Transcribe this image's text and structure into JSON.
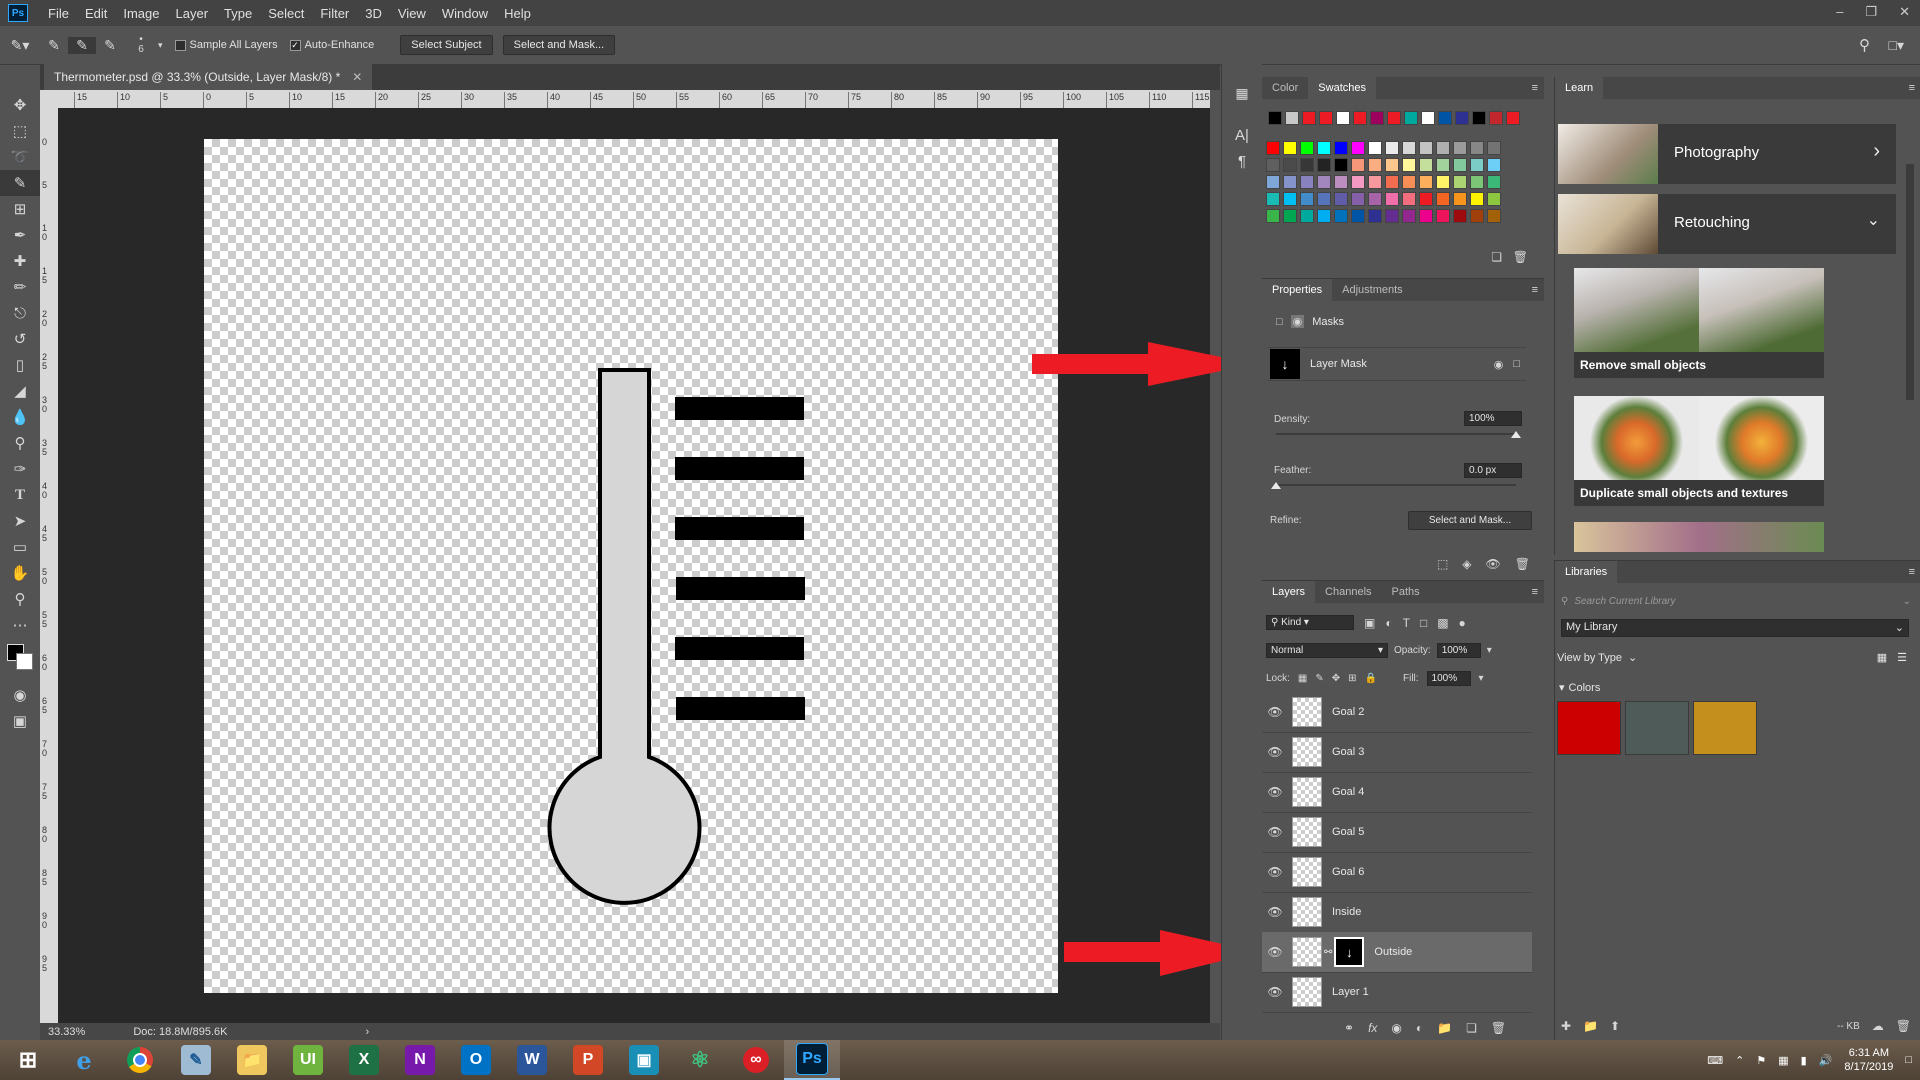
{
  "menu": [
    "File",
    "Edit",
    "Image",
    "Layer",
    "Type",
    "Select",
    "Filter",
    "3D",
    "View",
    "Window",
    "Help"
  ],
  "app_logo": "Ps",
  "options": {
    "brush_size": "6",
    "sample_all_layers": "Sample All Layers",
    "auto_enhance": "Auto-Enhance",
    "select_subject": "Select Subject",
    "select_and_mask": "Select and Mask..."
  },
  "document": {
    "tab_title": "Thermometer.psd @ 33.3% (Outside, Layer Mask/8) *",
    "zoom": "33.33%",
    "doc_size": "Doc: 18.8M/895.6K"
  },
  "ruler_top_labels": [
    "15",
    "10",
    "5",
    "0",
    "5",
    "10",
    "15",
    "20",
    "25",
    "30",
    "35",
    "40",
    "45",
    "50",
    "55",
    "60",
    "65",
    "70",
    "75",
    "80",
    "85",
    "90",
    "95",
    "100",
    "105",
    "110",
    "115"
  ],
  "ruler_left_labels": [
    "0",
    "5",
    "1 0",
    "1 5",
    "2 0",
    "2 5",
    "3 0",
    "3 5",
    "4 0",
    "4 5",
    "5 0",
    "5 5",
    "6 0",
    "6 5",
    "7 0",
    "7 5",
    "8 0",
    "8 5",
    "9 0",
    "9 5"
  ],
  "swatches_panel": {
    "tabs": [
      "Color",
      "Swatches"
    ],
    "active": "Swatches",
    "recent": [
      "#000000",
      "#c8c8c8",
      "#ed1c24",
      "#ed1c24",
      "#ffffff",
      "#ed1c24",
      "#9e005d",
      "#ed1c24",
      "#00a99d",
      "#ffffff",
      "#0054a6",
      "#2e3192",
      "#000000",
      "#c1272d",
      "#ed1c24"
    ],
    "grid": [
      [
        "#ff0000",
        "#ffff00",
        "#00ff00",
        "#00ffff",
        "#0000ff",
        "#ff00ff",
        "#ffffff",
        "#ebebeb",
        "#d7d7d7",
        "#c3c3c3",
        "#afafaf",
        "#9b9b9b",
        "#878787",
        "#737373"
      ],
      [
        "#5f5f5f",
        "#4b4b4b",
        "#373737",
        "#232323",
        "#000000",
        "#f7977a",
        "#f9ad81",
        "#fdc68a",
        "#fff79a",
        "#c4df9b",
        "#a3d39c",
        "#82ca9d",
        "#7bcdc8",
        "#6ecff6"
      ],
      [
        "#7ea7d8",
        "#8493ca",
        "#8882be",
        "#a187be",
        "#bc8dbf",
        "#f49ac2",
        "#f6989d",
        "#f26c4f",
        "#f68e55",
        "#fbaf5c",
        "#fff467",
        "#acd372",
        "#7cc576",
        "#3bb878"
      ],
      [
        "#1abbb4",
        "#00bff3",
        "#438cca",
        "#5574b9",
        "#605ca8",
        "#855fa8",
        "#a763a8",
        "#f06ea9",
        "#f26d7d",
        "#ed1c24",
        "#f26522",
        "#f7941d",
        "#fff200",
        "#8dc73f"
      ],
      [
        "#39b54a",
        "#00a651",
        "#00a99d",
        "#00aeef",
        "#0072bc",
        "#0054a6",
        "#2e3192",
        "#662d91",
        "#92278f",
        "#ec008c",
        "#ed145b",
        "#9e0b0f",
        "#a0410d",
        "#a36209"
      ]
    ]
  },
  "properties_panel": {
    "tabs": [
      "Properties",
      "Adjustments"
    ],
    "active": "Properties",
    "masks_label": "Masks",
    "layer_mask_label": "Layer Mask",
    "density_label": "Density:",
    "density_value": "100%",
    "density_level": 1.0,
    "feather_label": "Feather:",
    "feather_value": "0.0 px",
    "feather_level": 0.0,
    "refine_label": "Refine:",
    "select_and_mask": "Select and Mask..."
  },
  "layers_panel": {
    "tabs": [
      "Layers",
      "Channels",
      "Paths"
    ],
    "active": "Layers",
    "kind": "Kind",
    "blend_mode": "Normal",
    "opacity_label": "Opacity:",
    "opacity_value": "100%",
    "lock_label": "Lock:",
    "fill_label": "Fill:",
    "fill_value": "100%",
    "layers": [
      {
        "name": "Goal 2"
      },
      {
        "name": "Goal 3"
      },
      {
        "name": "Goal 4"
      },
      {
        "name": "Goal 5"
      },
      {
        "name": "Goal 6"
      },
      {
        "name": "Inside"
      },
      {
        "name": "Outside"
      },
      {
        "name": "Layer 1"
      }
    ]
  },
  "learn_panel": {
    "title": "Learn",
    "sections": [
      {
        "label": "Photography",
        "chevron": "chevron-right-icon"
      },
      {
        "label": "Retouching",
        "chevron": "chevron-down-icon"
      }
    ],
    "cards": [
      "Remove small objects",
      "Duplicate small objects and textures"
    ]
  },
  "libraries_panel": {
    "title": "Libraries",
    "search_placeholder": "Search Current Library",
    "library": "My Library",
    "view_by": "View by Type",
    "colors_label": "Colors",
    "colors": [
      "#cc0000",
      "#4f5b58",
      "#c58f1e"
    ],
    "size_label": "-- KB"
  },
  "taskbar": {
    "apps": [
      "windows-start",
      "internet-explorer",
      "chrome",
      "paint",
      "file-explorer",
      "ui",
      "excel",
      "onenote",
      "outlook",
      "word",
      "powerpoint",
      "app",
      "atom",
      "creative-cloud",
      "photoshop"
    ],
    "time": "6:31 AM",
    "date": "8/17/2019"
  },
  "accent_colors": {
    "arrow": "#ed1c24",
    "thermo_fill": "#d6d6d6",
    "thermo_stroke": "#000000"
  }
}
